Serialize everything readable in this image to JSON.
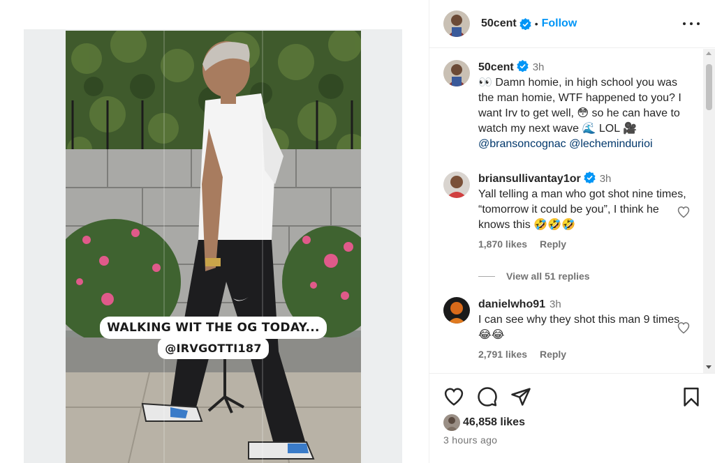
{
  "post": {
    "caption_overlay": {
      "line1": "WALKING WIT THE OG TODAY...",
      "line2": "@IRVGOTTI187"
    }
  },
  "header": {
    "username": "50cent",
    "separator": "•",
    "follow_label": "Follow",
    "more_icon": "more-horizontal-icon"
  },
  "caption": {
    "username": "50cent",
    "time": "3h",
    "text_part1": "👀 Damn homie, in high school you was the man homie, WTF happened to you? I want Irv to get well, 😳 so he can have to watch my next wave 🌊 LOL 🎥",
    "mention1": "@bransoncognac",
    "mention2": "@lechemindurioi"
  },
  "comments": [
    {
      "username": "briansullivantay1or",
      "time": "3h",
      "text": "Yall telling a man who got shot nine times, “tomorrow it could be you”, I think he knows this 🤣🤣🤣",
      "likes": "1,870 likes",
      "reply": "Reply"
    },
    {
      "username": "danielwho91",
      "time": "3h",
      "text": "I can see why they shot this man 9 times 😂😂",
      "likes": "2,791 likes",
      "reply": "Reply"
    }
  ],
  "view_replies": "View all 51 replies",
  "actions": {
    "icons": [
      "heart-icon",
      "comment-icon",
      "share-icon",
      "bookmark-icon"
    ]
  },
  "likes": "46,858 likes",
  "timestamp": "3 hours ago",
  "colors": {
    "accent": "#0095f6",
    "mention": "#00376b",
    "muted": "#737373",
    "text": "#262626"
  }
}
